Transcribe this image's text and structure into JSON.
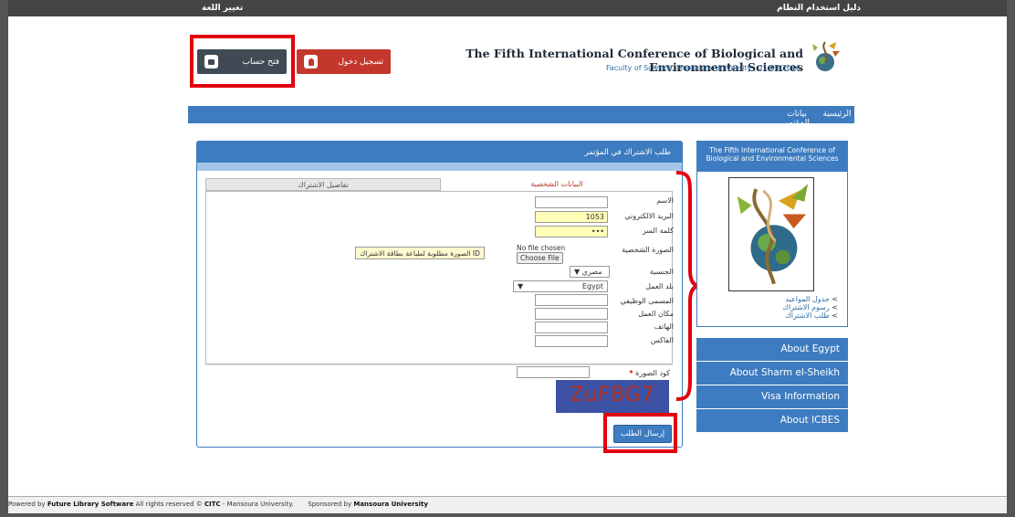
{
  "topbar": {
    "change_language": "تغيير اللغة",
    "user_guide": "دليل استخدام النظام"
  },
  "header": {
    "open_account": "فتح حساب",
    "login": "تسجيل دخول",
    "conference_title": "The Fifth International Conference of Biological and Environmental Sciences",
    "conference_subtitle": "Faculty of Science, Mansoura University , 21/03/2016"
  },
  "nav": {
    "home": "الرئيسية",
    "conference_info": "بيانات المؤتمر"
  },
  "form": {
    "panel_title": "طلب الاشتراك في المؤتمر",
    "tab_personal": "البيانات الشخصية",
    "tab_details": "تفاصيل الاشتراك",
    "fields": {
      "name_label": "الاسم",
      "email_label": "البريد الالكتروني",
      "email_value": "1053",
      "password_label": "كلمة السر",
      "password_value": "•••",
      "photo_label": "الصورة الشخصية",
      "choose_file": "Choose File",
      "no_file": "No file chosen",
      "photo_tooltip": "الصورة مطلوبة لطباعة بطاقة الاشتراك ID",
      "nationality_label": "الجنسية",
      "nationality_value": "مصري",
      "country_label": "بلد العمل",
      "country_value": "Egypt",
      "job_title_label": "المسمى الوظيفي",
      "workplace_label": "مكان العمل",
      "phone_label": "الهاتف",
      "fax_label": "الفاكس",
      "captcha_label": "كود الصورة",
      "captcha_required_mark": "*",
      "captcha_text": "ZuFBG7"
    },
    "submit": "إرسال الطلب"
  },
  "sidebar": {
    "box_title": "The Fifth International Conference of Biological and Environmental Sciences",
    "links": [
      "جدول المواعيد",
      "رسوم الاشتراك",
      "طلب الاشتراك"
    ],
    "buttons": [
      "About Egypt",
      "About Sharm el-Sheikh",
      "Visa Information",
      "About ICBES"
    ]
  },
  "footer": {
    "powered_by": "Powered by",
    "company": "Future Library Software",
    "rights": "All rights reserved ©",
    "citc": "CITC",
    "university_suffix": "- Mansoura University.",
    "sponsored_by": "Sponsored by",
    "sponsor": "Mansoura University"
  },
  "colors": {
    "primary": "#3d7cc0",
    "danger": "#c4372c",
    "dark": "#3f4a54",
    "highlight": "#e3000f"
  }
}
